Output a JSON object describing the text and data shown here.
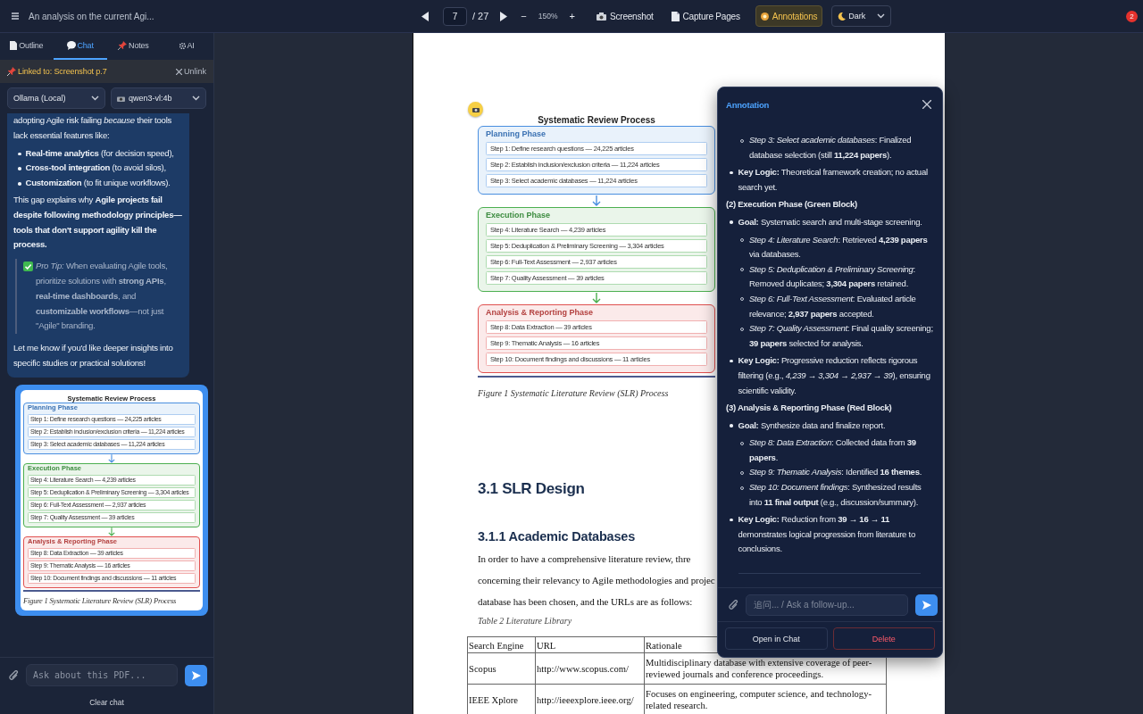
{
  "toolbar": {
    "title": "An analysis on the current Agi...",
    "page": "7",
    "page_total": "/ 27",
    "zoom_out": "−",
    "zoom": "150%",
    "zoom_in": "+",
    "screenshot": "Screenshot",
    "capture": "Capture Pages",
    "annotations": {
      "label": "Annotations",
      "on": true
    },
    "theme": "Dark",
    "notifications": "2"
  },
  "sidebar": {
    "tabs": [
      {
        "label": "Outline",
        "selected": false
      },
      {
        "label": "Chat",
        "selected": true
      },
      {
        "label": "Notes",
        "selected": false
      },
      {
        "label": "AI",
        "selected": false
      }
    ],
    "link": {
      "label": "Linked to: Screenshot p.7",
      "action": "Unlink"
    },
    "provider": "Ollama (Local)",
    "model": "qwen3-vl:4b",
    "message": [
      {
        "kind": "paragraph",
        "text": "adopting Agile risk failing *because* their tools lack essential features like:"
      },
      {
        "kind": "list",
        "items": [
          "**Real-time analytics** (for decision speed),",
          "**Cross-tool integration** (to avoid silos),",
          "**Customization** (to fit unique workflows)."
        ]
      },
      {
        "kind": "paragraph",
        "text": "This gap explains why **Agile projects fail despite following methodology principles—tools that don't support agility kill the process.**"
      },
      {
        "kind": "quote",
        "text": "*Pro Tip:* When evaluating Agile tools, prioritize solutions with **strong APIs**, **real-time dashboards**, and **customizable workflows**—not just \"Agile\" branding."
      },
      {
        "kind": "paragraph",
        "text": "Let me know if you'd like deeper insights into specific studies or practical solutions!"
      }
    ],
    "screenshot_figure": {
      "title": "Systematic Review Process",
      "phases": [
        {
          "name": "Planning Phase",
          "color": "#4a8fe0",
          "steps": [
            "Step 1: Define research questions — 24,225 articles",
            "Step 2: Establish inclusion/exclusion criteria — 11,224 articles",
            "Step 3: Select academic databases — 11,224 articles"
          ]
        },
        {
          "name": "Execution Phase",
          "color": "#4caf50",
          "steps": [
            "Step 4: Literature Search — 4,239 articles",
            "Step 5: Deduplication & Preliminary Screening — 3,304 articles",
            "Step 6: Full-Text Assessment — 2,937 articles",
            "Step 7: Quality Assessment — 39 articles"
          ]
        },
        {
          "name": "Analysis & Reporting Phase",
          "color": "#e0504f",
          "steps": [
            "Step 8: Data Extraction — 39 articles",
            "Step 9: Thematic Analysis — 16 articles",
            "Step 10: Document findings and discussions — 11 articles"
          ]
        }
      ],
      "caption": "Figure 1 Systematic Literature Review (SLR) Process"
    },
    "input": {
      "placeholder": "Ask about this PDF..."
    },
    "clear": "Clear chat"
  },
  "document": {
    "figure": {
      "title": "Systematic Review Process",
      "phases": [
        {
          "name": "Planning Phase",
          "color": "#4a8fe0",
          "steps": [
            "Step 1: Define research questions — 24,225 articles",
            "Step 2: Establish inclusion/exclusion criteria — 11,224 articles",
            "Step 3: Select academic databases — 11,224 articles"
          ]
        },
        {
          "name": "Execution Phase",
          "color": "#4caf50",
          "steps": [
            "Step 4: Literature Search — 4,239 articles",
            "Step 5: Deduplication & Preliminary Screening — 3,304 articles",
            "Step 6: Full-Text Assessment — 2,937 articles",
            "Step 7: Quality Assessment — 39 articles"
          ]
        },
        {
          "name": "Analysis & Reporting Phase",
          "color": "#e0504f",
          "steps": [
            "Step 8: Data Extraction — 39 articles",
            "Step 9: Thematic Analysis — 16 articles",
            "Step 10: Document findings and discussions — 11 articles"
          ]
        }
      ],
      "caption": "Figure 1 Systematic Literature Review (SLR) Process"
    },
    "heading": "3.1 SLR Design",
    "subheading": "3.1.1 Academic Databases",
    "paragraph_lines": [
      "In order to have a comprehensive literature review, thre",
      "concerning their relevancy to Agile methodologies and projec",
      "database has been chosen, and the URLs are as follows:"
    ],
    "table_caption": "Table 2 Literature Library",
    "table": {
      "columns": [
        "Search Engine",
        "URL",
        "Rationale"
      ],
      "rows": [
        [
          "Scopus",
          "http://www.scopus.com/",
          "Multidisciplinary database with extensive coverage of peer-reviewed journals and conference proceedings."
        ],
        [
          "IEEE Xplore",
          "http://ieeexplore.ieee.org/",
          "Focuses on engineering, computer science, and technology-related research."
        ]
      ]
    }
  },
  "annotation": {
    "title": "Annotation",
    "blocks": [
      {
        "kind": "sub",
        "text": "*Step 3: Select academic databases*: Finalized database selection (still **11,224 papers**)."
      },
      {
        "kind": "bullet",
        "text": "**Key Logic:** Theoretical framework creation; no actual search yet."
      },
      {
        "kind": "heading",
        "text": "(2) Execution Phase (Green Block)"
      },
      {
        "kind": "bullet",
        "text": "**Goal:** Systematic search and multi-stage screening.",
        "children": [
          "*Step 4: Literature Search*: Retrieved **4,239 papers** via databases.",
          "*Step 5: Deduplication & Preliminary Screening*: Removed duplicates; **3,304 papers** retained.",
          "*Step 6: Full-Text Assessment*: Evaluated article relevance; **2,937 papers** accepted.",
          "*Step 7: Quality Assessment*: Final quality screening; **39 papers** selected for analysis."
        ]
      },
      {
        "kind": "bullet",
        "text": "**Key Logic:** Progressive reduction reflects rigorous filtering (e.g., *4,239 → 3,304 → 2,937 → 39*), ensuring scientific validity."
      },
      {
        "kind": "heading",
        "text": "(3) Analysis & Reporting Phase (Red Block)"
      },
      {
        "kind": "bullet",
        "text": "**Goal:** Synthesize data and finalize report.",
        "children": [
          "*Step 8: Data Extraction*: Collected data from **39 papers**.",
          "*Step 9: Thematic Analysis*: Identified **16 themes**.",
          "*Step 10: Document findings*: Synthesized results into **11 final output** (e.g., discussion/summary)."
        ]
      },
      {
        "kind": "bullet",
        "text": "**Key Logic:** Reduction from **39 → 16 → 11** demonstrates logical progression from literature to conclusions."
      }
    ],
    "input_placeholder": "追问... / Ask a follow-up...",
    "buttons": [
      {
        "label": "Open in Chat",
        "kind": "secondary"
      },
      {
        "label": "Delete",
        "kind": "danger"
      }
    ]
  }
}
